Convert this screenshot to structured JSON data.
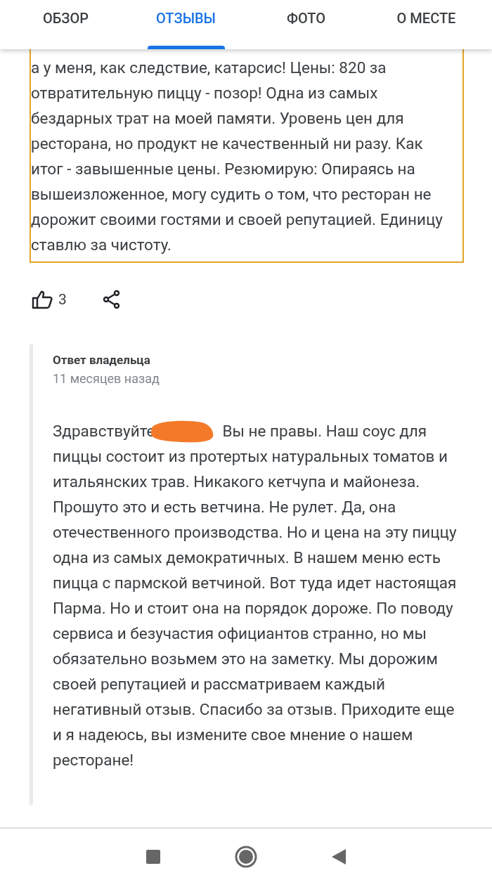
{
  "tabs": [
    {
      "label": "ОБЗОР",
      "selected": false
    },
    {
      "label": "ОТЗЫВЫ",
      "selected": true
    },
    {
      "label": "ФОТО",
      "selected": false
    },
    {
      "label": "О МЕСТЕ",
      "selected": false
    }
  ],
  "review": {
    "text": "а у меня, как следствие, катарсис! Цены: 820 за отвратительную пиццу - позор!  Одна из самых бездарных трат на моей памяти. Уровень цен для ресторана, но продукт не качественный ни разу. Как итог - завышенные цены. Резюмирую: Опираясь на вышеизложенное, могу судить о том, что ресторан не дорожит своими гостями и своей репутацией. Единицу ставлю за чистоту.",
    "likes": "3"
  },
  "owner_reply": {
    "title": "Ответ владельца",
    "time": "11 месяцев назад",
    "greeting": "Здравствуйте",
    "redacted": true,
    "text": "Вы не правы. Наш соус для пиццы состоит из протертых натуральных томатов и итальянских трав. Никакого кетчупа и майонеза. Прошуто это и есть ветчина. Не рулет. Да, она отечественного производства. Но и цена на эту пиццу одна из самых демократичных. В нашем меню есть пицца с пармской ветчиной. Вот туда идет настоящая Парма. Но и стоит она на порядок дороже. По поводу сервиса и безучастия официантов странно, но мы обязательно возьмем это на заметку. Мы дорожим своей репутацией и рассматриваем каждый негативный отзыв. Спасибо за отзыв. Приходите еще и я надеюсь, вы измените свое мнение о нашем ресторане!"
  }
}
